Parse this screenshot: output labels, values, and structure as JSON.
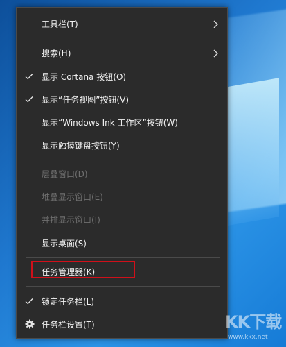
{
  "menu": {
    "items": [
      {
        "id": "toolbars",
        "label": "工具栏(T)",
        "checked": false,
        "submenu": true,
        "enabled": true
      },
      {
        "id": "search",
        "label": "搜索(H)",
        "checked": false,
        "submenu": true,
        "enabled": true
      },
      {
        "id": "show-cortana",
        "label": "显示 Cortana 按钮(O)",
        "checked": true,
        "submenu": false,
        "enabled": true
      },
      {
        "id": "show-task-view",
        "label": "显示“任务视图”按钮(V)",
        "checked": true,
        "submenu": false,
        "enabled": true
      },
      {
        "id": "show-ink",
        "label": "显示“Windows Ink 工作区”按钮(W)",
        "checked": false,
        "submenu": false,
        "enabled": true
      },
      {
        "id": "show-touch-keyboard",
        "label": "显示触摸键盘按钮(Y)",
        "checked": false,
        "submenu": false,
        "enabled": true
      },
      {
        "id": "cascade",
        "label": "层叠窗口(D)",
        "checked": false,
        "submenu": false,
        "enabled": false
      },
      {
        "id": "stacked",
        "label": "堆叠显示窗口(E)",
        "checked": false,
        "submenu": false,
        "enabled": false
      },
      {
        "id": "side-by-side",
        "label": "并排显示窗口(I)",
        "checked": false,
        "submenu": false,
        "enabled": false
      },
      {
        "id": "show-desktop",
        "label": "显示桌面(S)",
        "checked": false,
        "submenu": false,
        "enabled": true
      },
      {
        "id": "task-manager",
        "label": "任务管理器(K)",
        "checked": false,
        "submenu": false,
        "enabled": true,
        "highlighted": true
      },
      {
        "id": "lock-taskbar",
        "label": "锁定任务栏(L)",
        "checked": true,
        "submenu": false,
        "enabled": true
      },
      {
        "id": "taskbar-settings",
        "label": "任务栏设置(T)",
        "checked": false,
        "submenu": false,
        "enabled": true,
        "icon": "gear-icon"
      }
    ]
  },
  "colors": {
    "menu_background": "#2b2b2b",
    "text": "#f2f2f2",
    "disabled_text": "#6f6f6f",
    "highlight_border": "#d0101a",
    "desktop_blue": "#1f78cf"
  },
  "watermark": {
    "logo_text": "KK下载",
    "url": "www.kkx.net"
  }
}
